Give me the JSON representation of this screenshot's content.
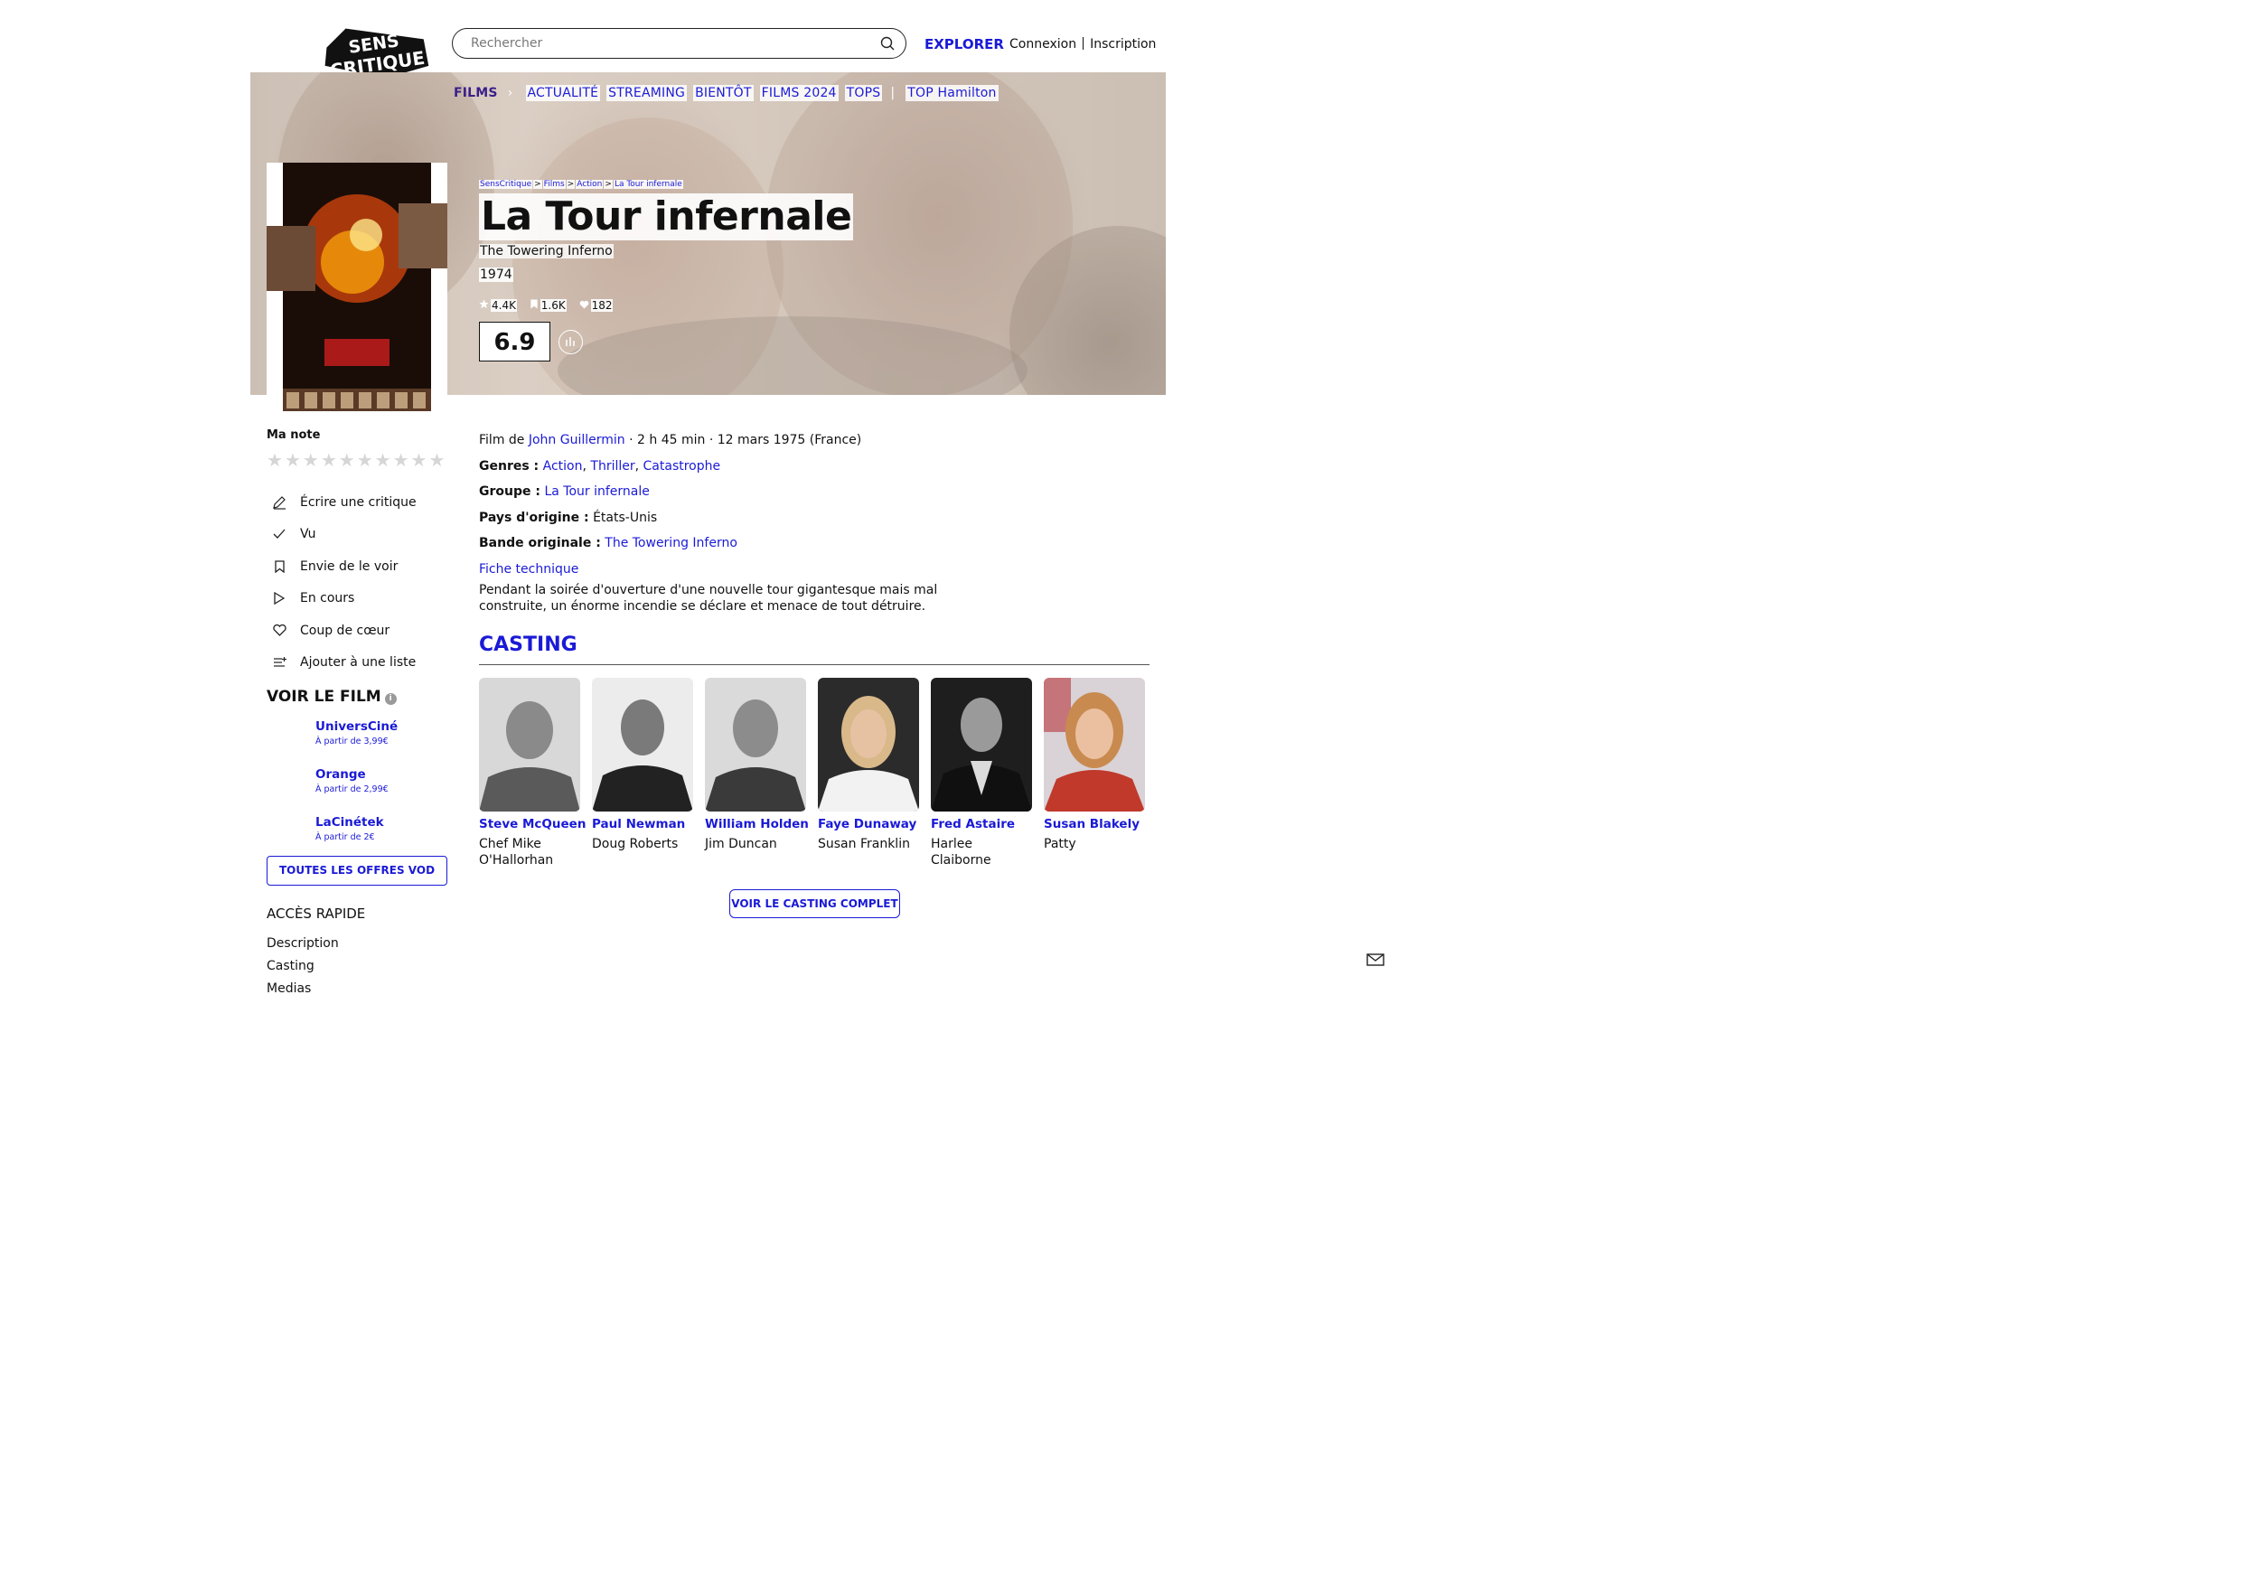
{
  "header": {
    "logo_lines": [
      "SENS",
      "CRITIQUE"
    ],
    "search_placeholder": "Rechercher",
    "explorer": "EXPLORER",
    "login": "Connexion",
    "signup": "Inscription"
  },
  "nav": {
    "films": "FILMS",
    "items": [
      "ACTUALITÉ",
      "STREAMING",
      "BIENTÔT",
      "FILMS 2024",
      "TOPS"
    ],
    "top": "TOP Hamilton"
  },
  "breadcrumb": [
    "SensCritique",
    "Films",
    "Action",
    "La Tour infernale"
  ],
  "movie": {
    "title": "La Tour infernale",
    "original_title": "The Towering Inferno",
    "year": "1974",
    "stats": {
      "ratings": "4.4K",
      "wishlist": "1.6K",
      "favorites": "182"
    },
    "score": "6.9"
  },
  "my_rating": {
    "label": "Ma note",
    "stars": 10
  },
  "actions": [
    "Écrire une critique",
    "Vu",
    "Envie de le voir",
    "En cours",
    "Coup de cœur",
    "Ajouter à une liste"
  ],
  "watch": {
    "title": "VOIR LE FILM",
    "offers": [
      {
        "name": "UniversCiné",
        "price": "À partir de 3,99€"
      },
      {
        "name": "Orange",
        "price": "À partir de 2,99€"
      },
      {
        "name": "LaCinétek",
        "price": "À partir de 2€"
      }
    ],
    "all_offers": "TOUTES LES OFFRES VOD"
  },
  "quick_access": {
    "title": "ACCÈS RAPIDE",
    "links": [
      "Description",
      "Casting",
      "Medias"
    ]
  },
  "details": {
    "film_by_prefix": "Film de",
    "director": "John Guillermin",
    "meta": "· 2 h 45 min · 12 mars 1975 (France)",
    "genres_label": "Genres :",
    "genres": [
      "Action",
      "Thriller",
      "Catastrophe"
    ],
    "group_label": "Groupe :",
    "group": "La Tour infernale",
    "country_label": "Pays d'origine :",
    "country": "États-Unis",
    "soundtrack_label": "Bande originale :",
    "soundtrack": "The Towering Inferno",
    "tech_sheet": "Fiche technique",
    "synopsis": "Pendant la soirée d'ouverture d'une nouvelle tour gigantesque mais mal construite, un énorme incendie se déclare et menace de tout détruire."
  },
  "casting": {
    "title": "CASTING",
    "members": [
      {
        "name": "Steve McQueen",
        "role": "Chef Mike O'Hallorhan"
      },
      {
        "name": "Paul Newman",
        "role": "Doug Roberts"
      },
      {
        "name": "William Holden",
        "role": "Jim Duncan"
      },
      {
        "name": "Faye Dunaway",
        "role": "Susan Franklin"
      },
      {
        "name": "Fred Astaire",
        "role": "Harlee Claiborne"
      },
      {
        "name": "Susan Blakely",
        "role": "Patty"
      }
    ],
    "full_cast": "VOIR LE CASTING COMPLET"
  },
  "colors": {
    "accent": "#1a1ad6",
    "nav_active": "#3b1e8a",
    "text": "#111111"
  }
}
